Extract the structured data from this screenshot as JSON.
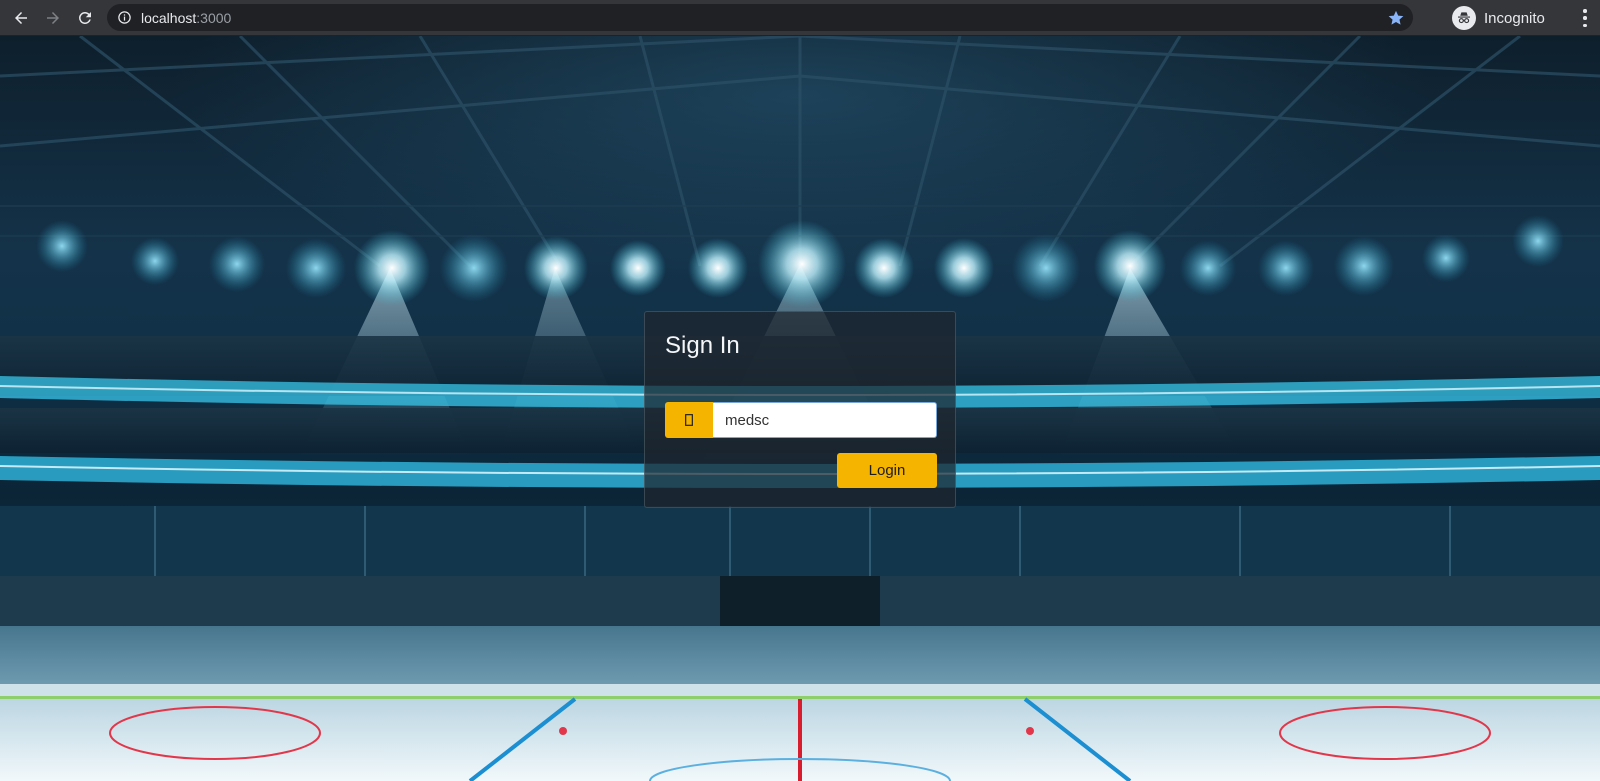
{
  "browser": {
    "url_host": "localhost",
    "url_port": ":3000",
    "profile_label": "Incognito",
    "icons": {
      "back": "arrow-left-icon",
      "forward": "arrow-right-icon",
      "reload": "reload-icon",
      "site_info": "info-icon",
      "bookmark": "star-icon",
      "incognito": "incognito-icon",
      "menu": "kebab-menu-icon"
    }
  },
  "signin": {
    "title": "Sign In",
    "username_value": "medsc",
    "user_icon": "user-icon",
    "login_label": "Login"
  },
  "colors": {
    "accent": "#f5b400",
    "chrome_bg": "#35363a",
    "omnibox_bg": "#202124",
    "bookmark_star": "#8ab4f8"
  }
}
